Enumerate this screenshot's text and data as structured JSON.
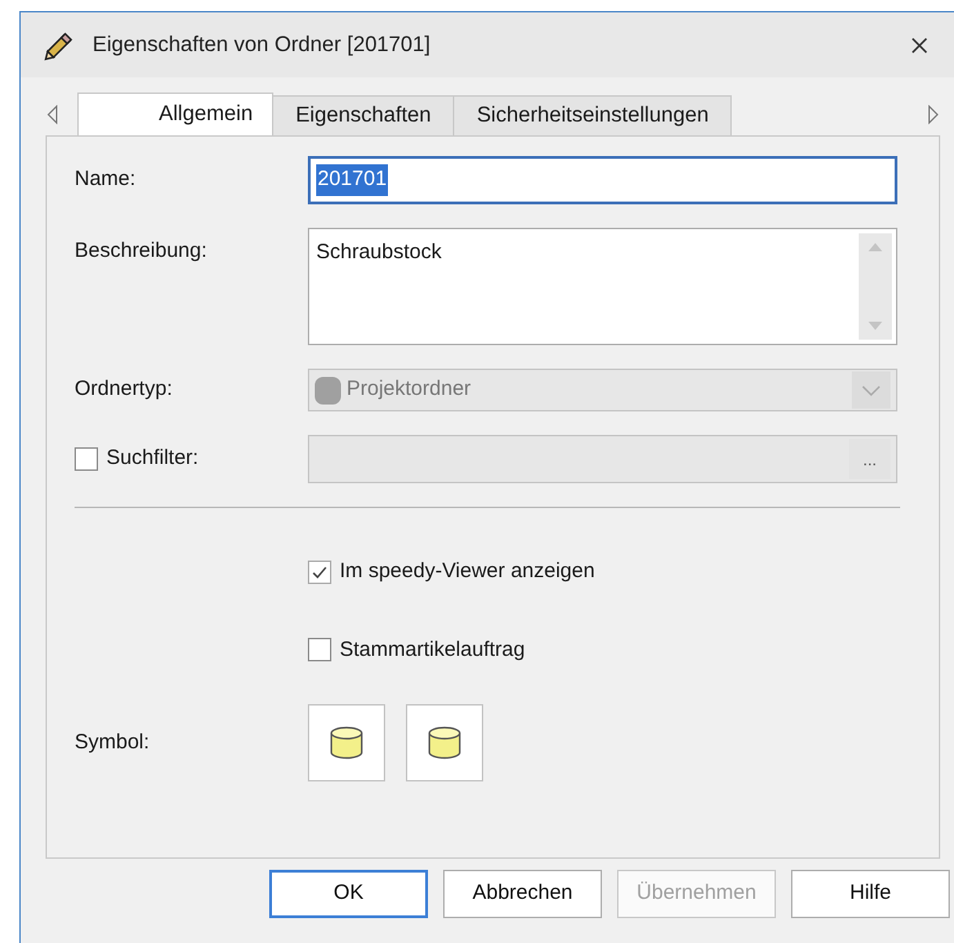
{
  "window": {
    "title": "Eigenschaften von Ordner [201701]"
  },
  "tabs": [
    {
      "label": "Allgemein",
      "selected": true
    },
    {
      "label": "Eigenschaften",
      "selected": false
    },
    {
      "label": "Sicherheitseinstellungen",
      "selected": false
    }
  ],
  "fields": [
    {
      "kind": "text",
      "label": "Name:",
      "value": "201701",
      "value_selected": true,
      "disabled": false
    },
    {
      "kind": "textarea",
      "label": "Beschreibung:",
      "value": "Schraubstock",
      "disabled": false
    },
    {
      "kind": "combo",
      "label": "Ordnertyp:",
      "value": "Projektordner",
      "disabled": true
    },
    {
      "kind": "filter",
      "label": "Suchfilter:",
      "checked": false,
      "button": "...",
      "disabled": true
    }
  ],
  "options": [
    {
      "label": "Im speedy-Viewer anzeigen",
      "checked": true
    },
    {
      "label": "Stammartikelauftrag",
      "checked": false
    }
  ],
  "symbol": {
    "label": "Symbol:"
  },
  "buttons": [
    {
      "label": "OK",
      "default": true,
      "disabled": false
    },
    {
      "label": "Abbrechen",
      "default": false,
      "disabled": false
    },
    {
      "label": "Übernehmen",
      "default": false,
      "disabled": true
    },
    {
      "label": "Hilfe",
      "default": false,
      "disabled": false
    }
  ]
}
